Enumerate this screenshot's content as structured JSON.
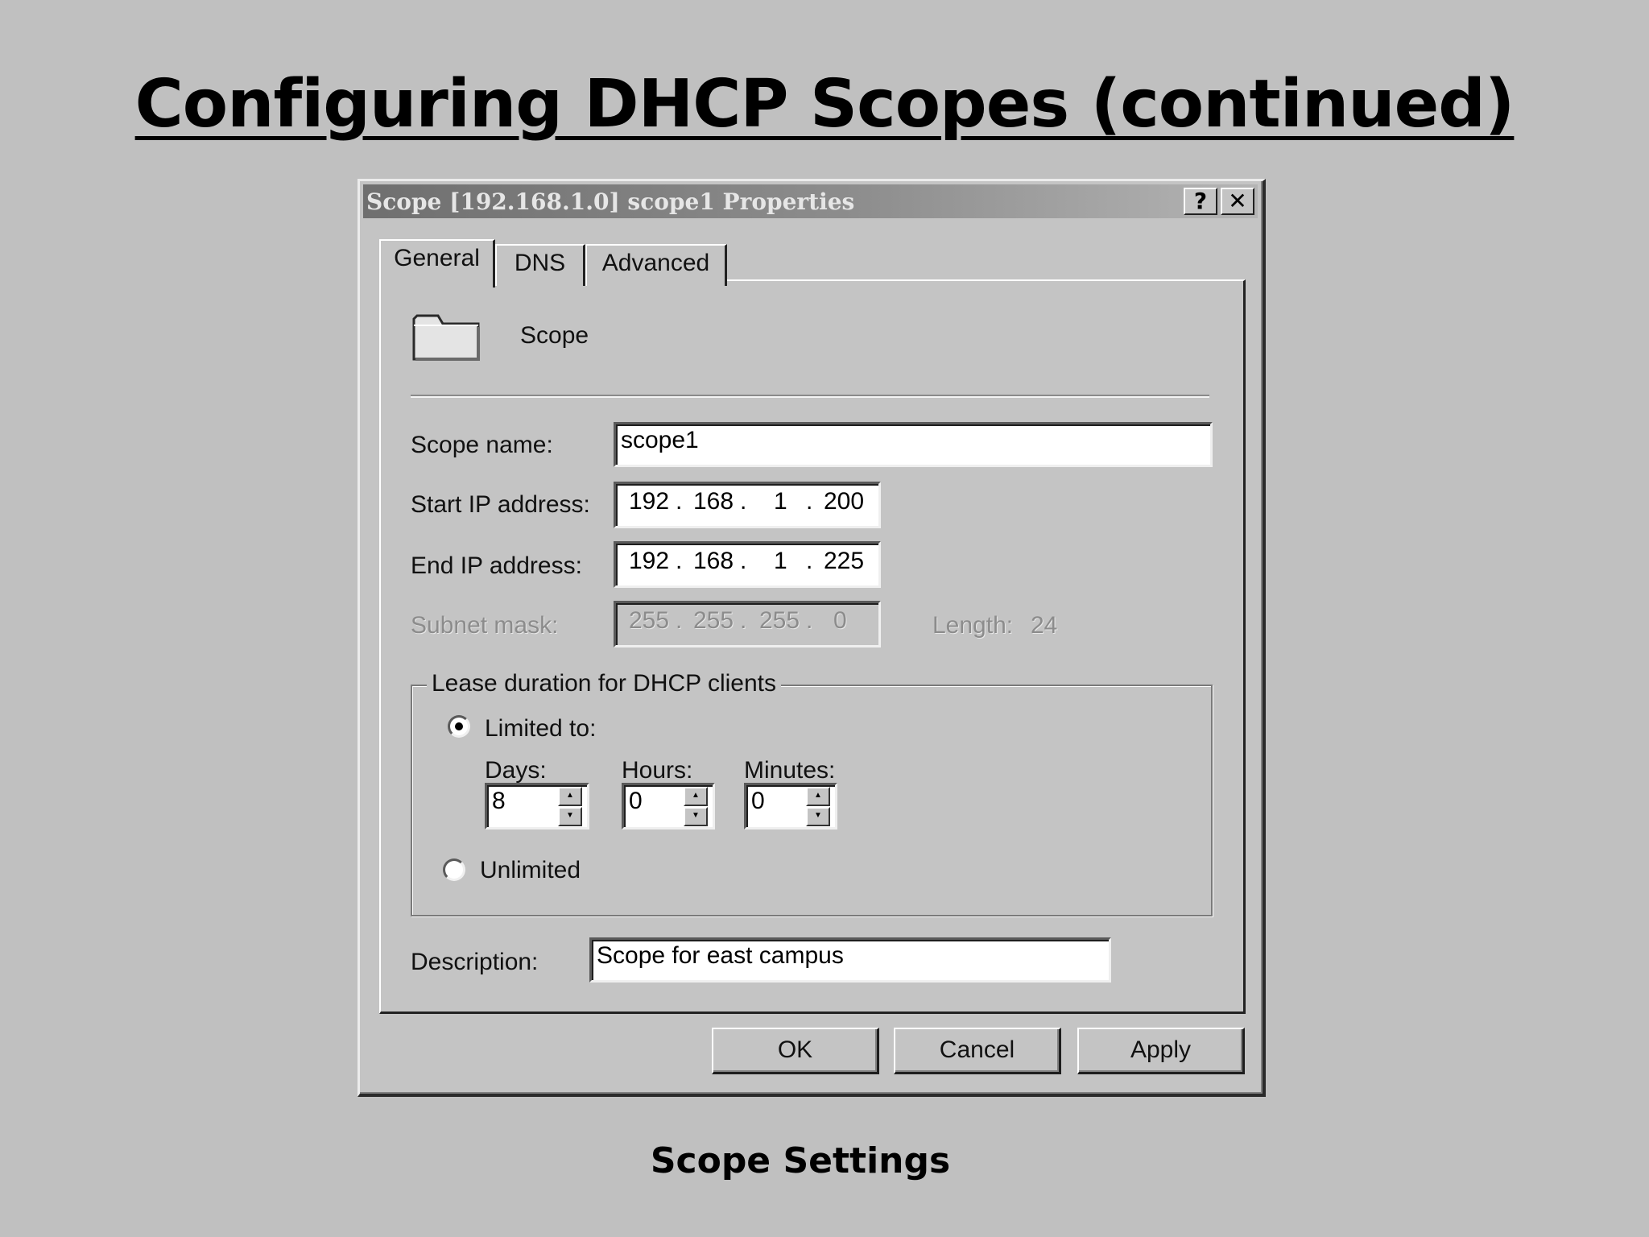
{
  "slide": {
    "title": "Configuring DHCP Scopes (continued)",
    "caption": "Scope Settings"
  },
  "dialog": {
    "title": "Scope [192.168.1.0] scope1 Properties",
    "help_label": "?",
    "close_label": "✕",
    "tabs": [
      {
        "label": "General",
        "active": true
      },
      {
        "label": "DNS",
        "active": false
      },
      {
        "label": "Advanced",
        "active": false
      }
    ],
    "header": {
      "icon": "folder-icon",
      "label": "Scope"
    },
    "fields": {
      "scope_name": {
        "label": "Scope name:",
        "value": "scope1"
      },
      "start_ip": {
        "label": "Start IP address:",
        "octets": [
          "192",
          "168",
          "1",
          "200"
        ]
      },
      "end_ip": {
        "label": "End IP address:",
        "octets": [
          "192",
          "168",
          "1",
          "225"
        ]
      },
      "subnet_mask": {
        "label": "Subnet mask:",
        "octets": [
          "255",
          "255",
          "255",
          "0"
        ],
        "disabled": true
      },
      "length": {
        "label": "Length:",
        "value": "24"
      }
    },
    "lease": {
      "group_label": "Lease duration for DHCP clients",
      "limited": {
        "label": "Limited to:",
        "selected": true
      },
      "days": {
        "label": "Days:",
        "value": "8"
      },
      "hours": {
        "label": "Hours:",
        "value": "0"
      },
      "minutes": {
        "label": "Minutes:",
        "value": "0"
      },
      "unlimited": {
        "label": "Unlimited",
        "selected": false
      }
    },
    "description": {
      "label": "Description:",
      "value": "Scope for east campus"
    },
    "buttons": {
      "ok": "OK",
      "cancel": "Cancel",
      "apply": "Apply"
    }
  }
}
